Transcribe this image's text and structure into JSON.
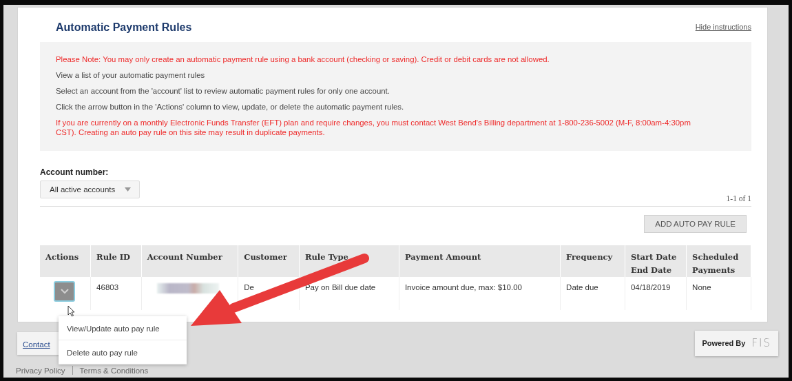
{
  "title": "Automatic Payment Rules",
  "hide_link": "Hide instructions",
  "instructions": [
    {
      "text": "Please Note: You may only create an automatic payment rule using a bank account (checking or saving). Credit or debit cards are not allowed.",
      "kind": "warning"
    },
    {
      "text": "View a list of your automatic payment rules",
      "kind": "info"
    },
    {
      "text": "Select an account from the 'account' list to review automatic payment rules for only one account.",
      "kind": "info"
    },
    {
      "text": "Click the arrow button in the 'Actions' column to view, update, or delete the automatic payment rules.",
      "kind": "info"
    },
    {
      "text": "If you are currently on a monthly Electronic Funds Transfer (EFT) plan and require changes, you must contact West Bend's Billing department at 1-800-236-5002 (M-F, 8:00am-4:30pm CST). Creating an auto pay rule on this site may result in duplicate payments.",
      "kind": "warning"
    }
  ],
  "account_filter": {
    "label": "Account number:",
    "value": "All active accounts"
  },
  "pager": "1-1 of 1",
  "add_button": "ADD AUTO PAY RULE",
  "table": {
    "columns": [
      "Actions",
      "Rule ID",
      "Account Number",
      "Customer",
      "Rule Type",
      "Payment Amount",
      "Frequency",
      "Start Date\nEnd Date",
      "Scheduled Payments"
    ],
    "rows": [
      {
        "rule_id": "46803",
        "customer": "De",
        "rule_type": "Pay on Bill due date",
        "payment_amount": "Invoice amount due, max: $10.00",
        "frequency": "Date due",
        "start_date": "04/18/2019",
        "scheduled": "None"
      }
    ]
  },
  "action_menu": {
    "expanded": true,
    "items": [
      "View/Update auto pay rule",
      "Delete auto pay rule"
    ]
  },
  "footer": {
    "contact": "Contact",
    "powered_by": "Powered By",
    "logo": "FIS",
    "links": [
      "Privacy Policy",
      "Terms & Conditions"
    ]
  }
}
